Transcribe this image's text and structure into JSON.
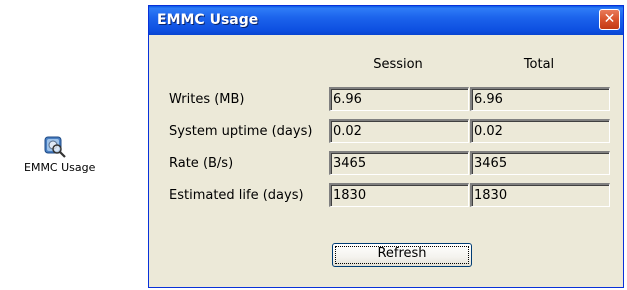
{
  "desktop": {
    "icon_label": "EMMC Usage",
    "icon_name": "disk-magnifier-icon"
  },
  "window": {
    "title": "EMMC Usage",
    "close_glyph": "✕",
    "columns": [
      "Session",
      "Total"
    ],
    "rows": [
      {
        "label": "Writes (MB)",
        "session": "6.96",
        "total": "6.96"
      },
      {
        "label": "System uptime (days)",
        "session": "0.02",
        "total": "0.02"
      },
      {
        "label": "Rate (B/s)",
        "session": "3465",
        "total": "3465"
      },
      {
        "label": "Estimated life (days)",
        "session": "1830",
        "total": "1830"
      }
    ],
    "refresh_label": "Refresh"
  },
  "colors": {
    "titlebar": "#0d4fe0",
    "close_button": "#d9532c",
    "window_bg": "#ece9d8"
  }
}
